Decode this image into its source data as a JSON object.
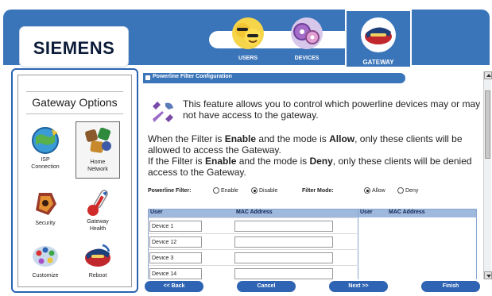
{
  "header": {
    "brand": "SIEMENS",
    "tabs": [
      {
        "id": "users",
        "label": "USERS"
      },
      {
        "id": "devices",
        "label": "DEVICES"
      },
      {
        "id": "gateway",
        "label": "GATEWAY",
        "active": true
      }
    ]
  },
  "sidebar": {
    "title": "Gateway Options",
    "items": [
      {
        "id": "isp",
        "label_line1": "ISP",
        "label_line2": "Connection",
        "icon": "globe-icon"
      },
      {
        "id": "home",
        "label_line1": "Home",
        "label_line2": "Network",
        "icon": "network-icon",
        "selected": true
      },
      {
        "id": "security",
        "label": "Security",
        "icon": "lock-icon"
      },
      {
        "id": "health",
        "label_line1": "Gateway",
        "label_line2": "Health",
        "icon": "thermometer-icon"
      },
      {
        "id": "customize",
        "label": "Customize",
        "icon": "palette-icon"
      },
      {
        "id": "reboot",
        "label": "Reboot",
        "icon": "reboot-icon"
      }
    ]
  },
  "main": {
    "section_title": "Powerline Filter Configuration",
    "intro": "This feature allows you to control which powerline devices may or may not have access to the gateway.",
    "enable_line": {
      "a": "When the Filter is ",
      "b": "Enable",
      "c": " and the mode is ",
      "d": "Allow",
      "e": ", only these clients will be allowed to access the Gateway."
    },
    "deny_line": {
      "a": "If the Filter is ",
      "b": "Enable",
      "c": " and the mode is ",
      "d": "Deny",
      "e": ", only these clients will be denied access to the Gateway."
    },
    "filter": {
      "label": "Powerline Filter:",
      "enable": "Enable",
      "disable": "Disable",
      "selected": "Disable"
    },
    "mode": {
      "label": "Filter Mode:",
      "allow": "Allow",
      "deny": "Deny",
      "selected": "Allow"
    },
    "table": {
      "col_user": "User",
      "col_mac": "MAC Address",
      "col_user2": "User",
      "col_mac2": "MAC Address",
      "rows": [
        {
          "user": "Device 1",
          "mac": ""
        },
        {
          "user": "Device 12",
          "mac": ""
        },
        {
          "user": "Device 3",
          "mac": ""
        },
        {
          "user": "Device 14",
          "mac": ""
        }
      ]
    }
  },
  "buttons": {
    "back": "<< Back",
    "cancel": "Cancel",
    "next": "Next >>",
    "finish": "Finish"
  },
  "colors": {
    "brand_blue": "#3a74b9",
    "button_blue": "#2e64b3",
    "table_header": "#9fb8dd"
  }
}
